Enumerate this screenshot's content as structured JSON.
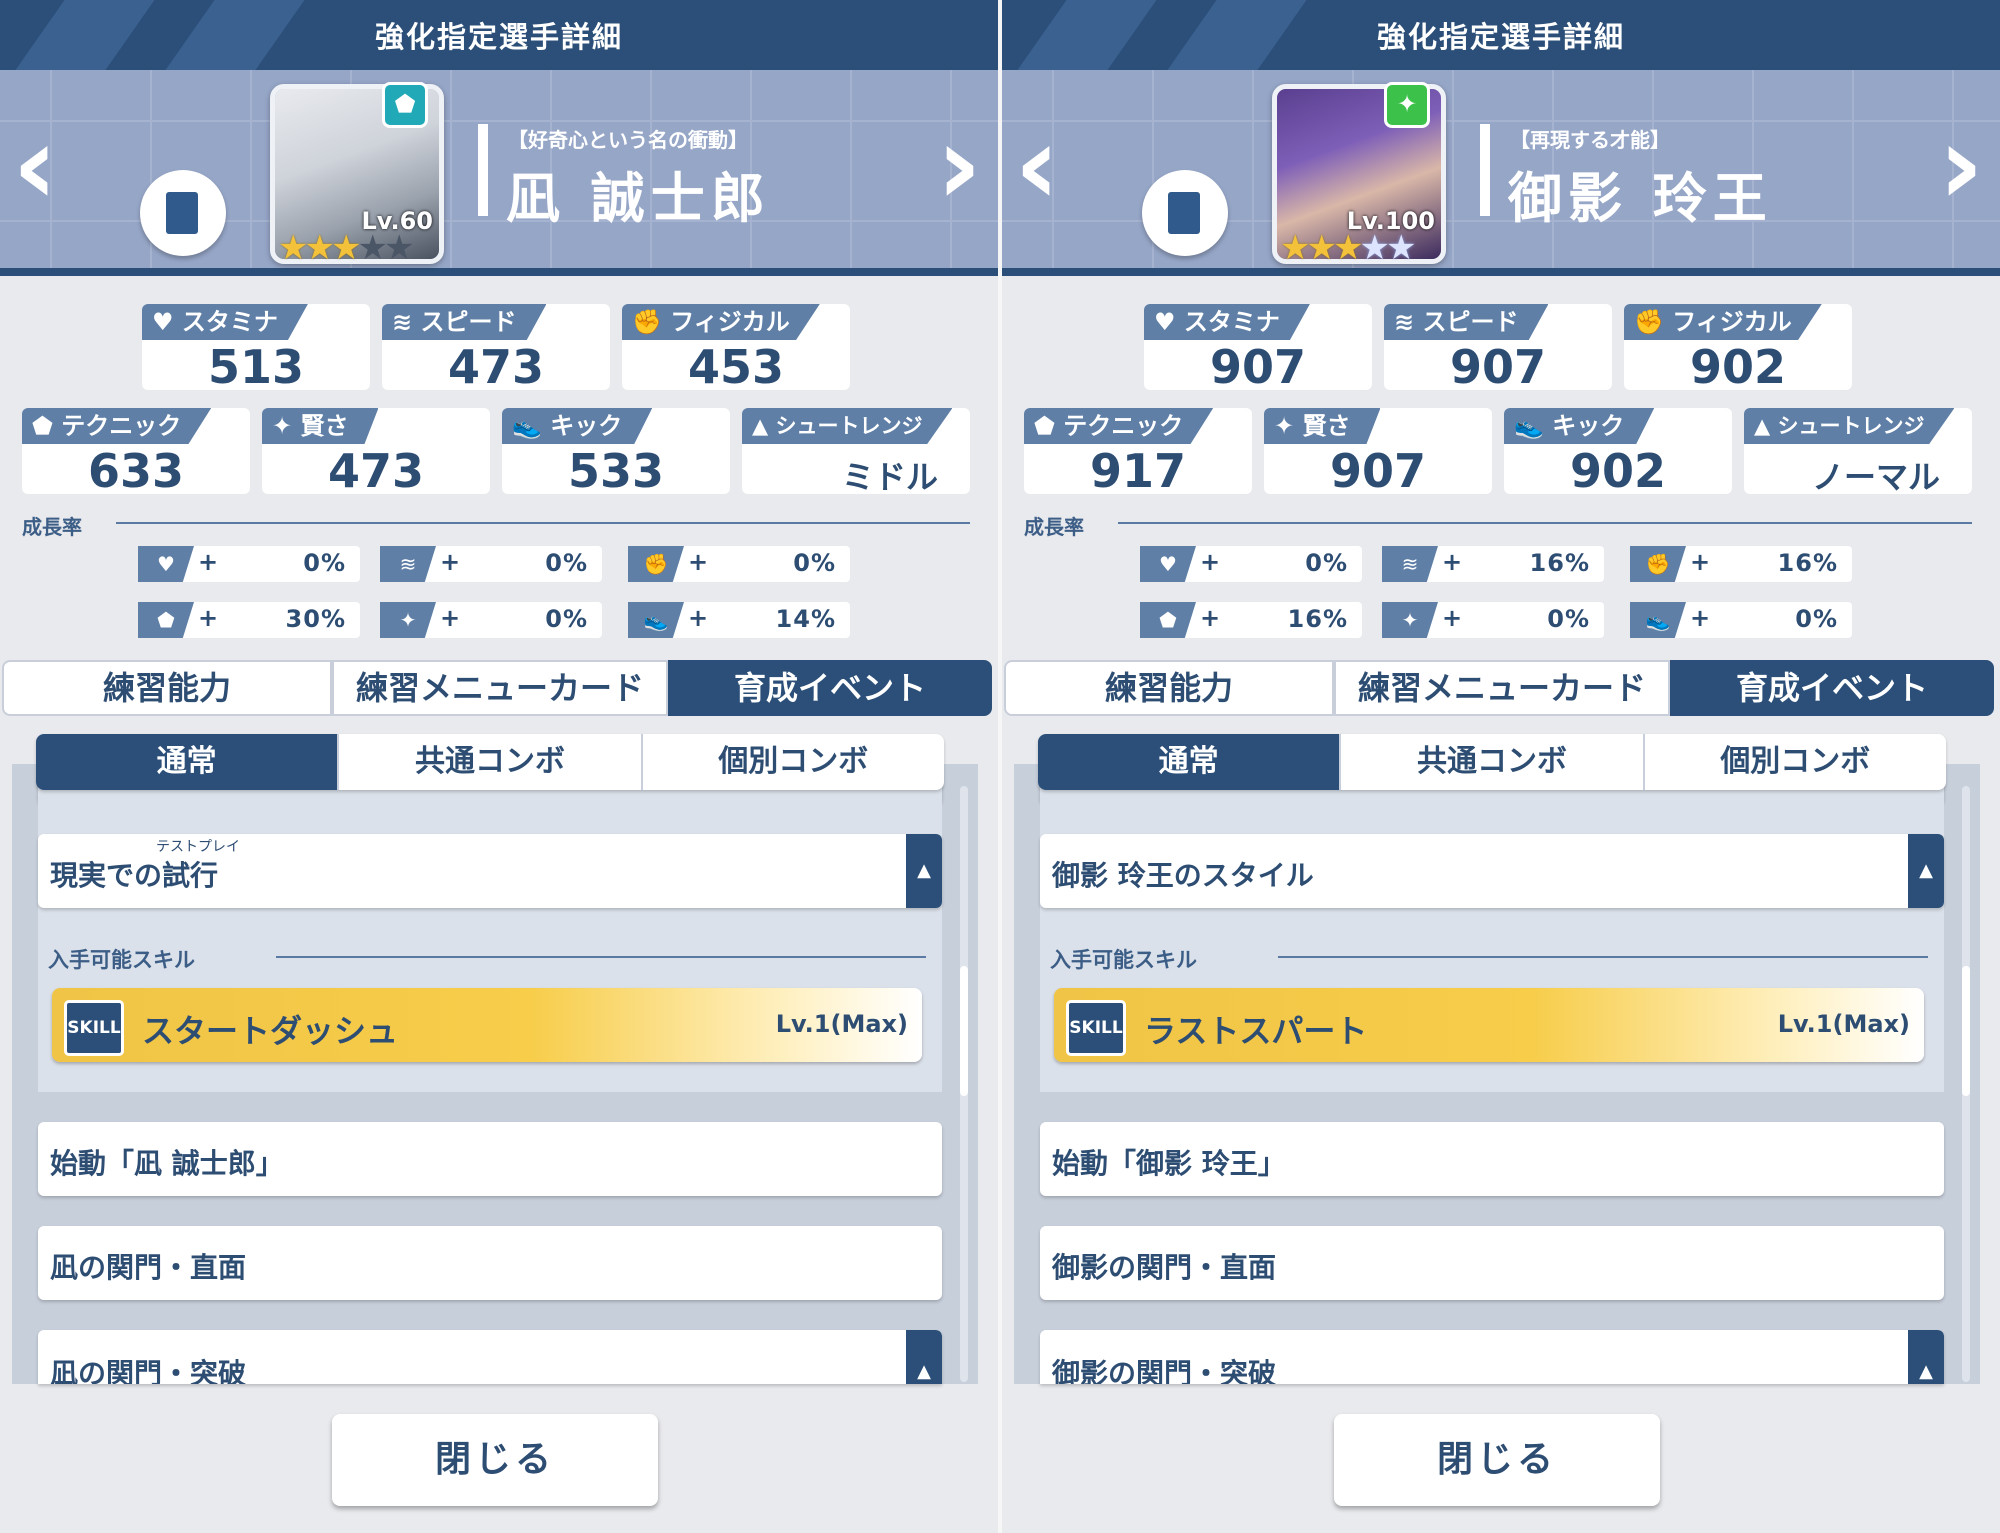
{
  "panels": [
    {
      "header_title": "強化指定選手詳細",
      "character": {
        "epithet": "【好奇心という名の衝動】",
        "name": "凪 誠士郎",
        "level": "Lv.60",
        "stars_filled": 3,
        "stars_total": 5,
        "badge_icon": "teal-pentagon-icon",
        "badge_color": "#21a9b8"
      },
      "stats": {
        "stamina": {
          "label": "スタミナ",
          "value": "513"
        },
        "speed": {
          "label": "スピード",
          "value": "473"
        },
        "physical": {
          "label": "フィジカル",
          "value": "453"
        },
        "technique": {
          "label": "テクニック",
          "value": "633"
        },
        "wisdom": {
          "label": "賢さ",
          "value": "473"
        },
        "kick": {
          "label": "キック",
          "value": "533"
        },
        "shoot_range": {
          "label": "シュートレンジ",
          "value": "ミドル"
        }
      },
      "growth_label": "成長率",
      "growth": [
        {
          "icon": "heart-icon",
          "plus": "+",
          "value": "0%"
        },
        {
          "icon": "runner-icon",
          "plus": "+",
          "value": "0%"
        },
        {
          "icon": "fist-icon",
          "plus": "+",
          "value": "0%"
        },
        {
          "icon": "pentagon-icon",
          "plus": "+",
          "value": "30%"
        },
        {
          "icon": "sparkle-icon",
          "plus": "+",
          "value": "0%"
        },
        {
          "icon": "boot-icon",
          "plus": "+",
          "value": "14%"
        }
      ],
      "tabs": [
        "練習能力",
        "練習メニューカード",
        "育成イベント"
      ],
      "subtabs": [
        "通常",
        "共通コンボ",
        "個別コンボ"
      ],
      "expanded_event": {
        "label": "現実での試行",
        "ruby": "テストプレイ"
      },
      "available_skill_label": "入手可能スキル",
      "skill": {
        "icon_text": "SKILL",
        "name": "スタートダッシュ",
        "level": "Lv.1(Max)"
      },
      "events": [
        "始動「凪 誠士郎」",
        "凪の関門・直面",
        "凪の関門・突破"
      ],
      "close_label": "閉じる"
    },
    {
      "header_title": "強化指定選手詳細",
      "character": {
        "epithet": "【再現する才能】",
        "name": "御影 玲王",
        "level": "Lv.100",
        "stars_filled": 3,
        "stars_total": 5,
        "badge_icon": "green-sparkle-icon",
        "badge_color": "#3cc24a"
      },
      "stats": {
        "stamina": {
          "label": "スタミナ",
          "value": "907"
        },
        "speed": {
          "label": "スピード",
          "value": "907"
        },
        "physical": {
          "label": "フィジカル",
          "value": "902"
        },
        "technique": {
          "label": "テクニック",
          "value": "917"
        },
        "wisdom": {
          "label": "賢さ",
          "value": "907"
        },
        "kick": {
          "label": "キック",
          "value": "902"
        },
        "shoot_range": {
          "label": "シュートレンジ",
          "value": "ノーマル"
        }
      },
      "growth_label": "成長率",
      "growth": [
        {
          "icon": "heart-icon",
          "plus": "+",
          "value": "0%"
        },
        {
          "icon": "runner-icon",
          "plus": "+",
          "value": "16%"
        },
        {
          "icon": "fist-icon",
          "plus": "+",
          "value": "16%"
        },
        {
          "icon": "pentagon-icon",
          "plus": "+",
          "value": "16%"
        },
        {
          "icon": "sparkle-icon",
          "plus": "+",
          "value": "0%"
        },
        {
          "icon": "boot-icon",
          "plus": "+",
          "value": "0%"
        }
      ],
      "tabs": [
        "練習能力",
        "練習メニューカード",
        "育成イベント"
      ],
      "subtabs": [
        "通常",
        "共通コンボ",
        "個別コンボ"
      ],
      "expanded_event": {
        "label": "御影 玲王のスタイル",
        "ruby": ""
      },
      "available_skill_label": "入手可能スキル",
      "skill": {
        "icon_text": "SKILL",
        "name": "ラストスパート",
        "level": "Lv.1(Max)"
      },
      "events": [
        "始動「御影 玲王」",
        "御影の関門・直面",
        "御影の関門・突破"
      ],
      "close_label": "閉じる"
    }
  ]
}
